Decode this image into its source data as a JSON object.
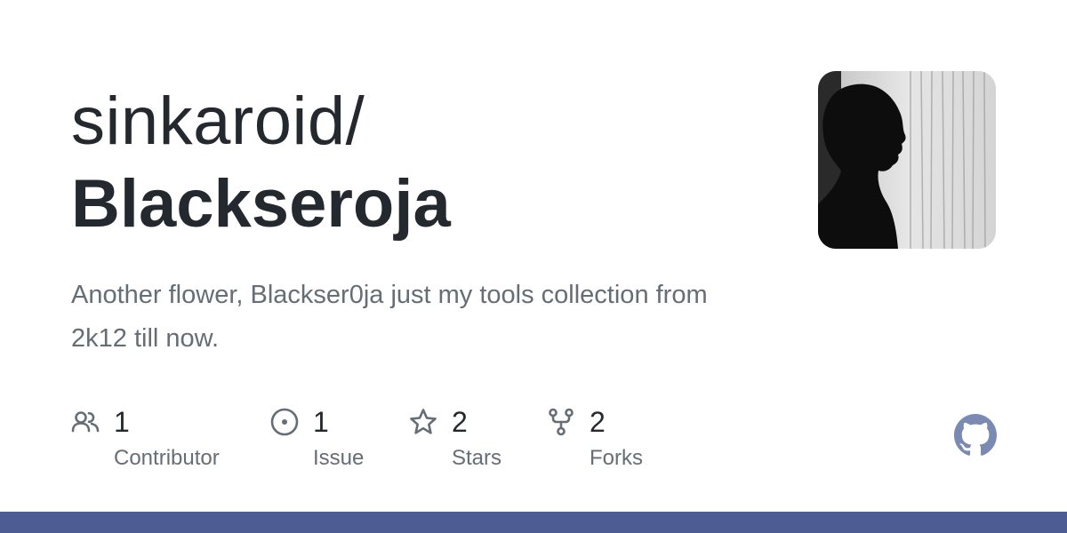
{
  "repo": {
    "owner": "sinkaroid/",
    "name": "Blackseroja",
    "description": "Another flower, Blackser0ja just my tools collection from 2k12 till now."
  },
  "stats": [
    {
      "icon": "people-icon",
      "value": "1",
      "label": "Contributor"
    },
    {
      "icon": "issue-icon",
      "value": "1",
      "label": "Issue"
    },
    {
      "icon": "star-icon",
      "value": "2",
      "label": "Stars"
    },
    {
      "icon": "fork-icon",
      "value": "2",
      "label": "Forks"
    }
  ],
  "colors": {
    "title": "#24292f",
    "muted": "#656d76",
    "bottom_bar": "#4d5c92",
    "github_logo": "#7a8ab2"
  },
  "icons": {
    "logo": "github-logo-icon",
    "avatar": "avatar-silhouette-image"
  }
}
